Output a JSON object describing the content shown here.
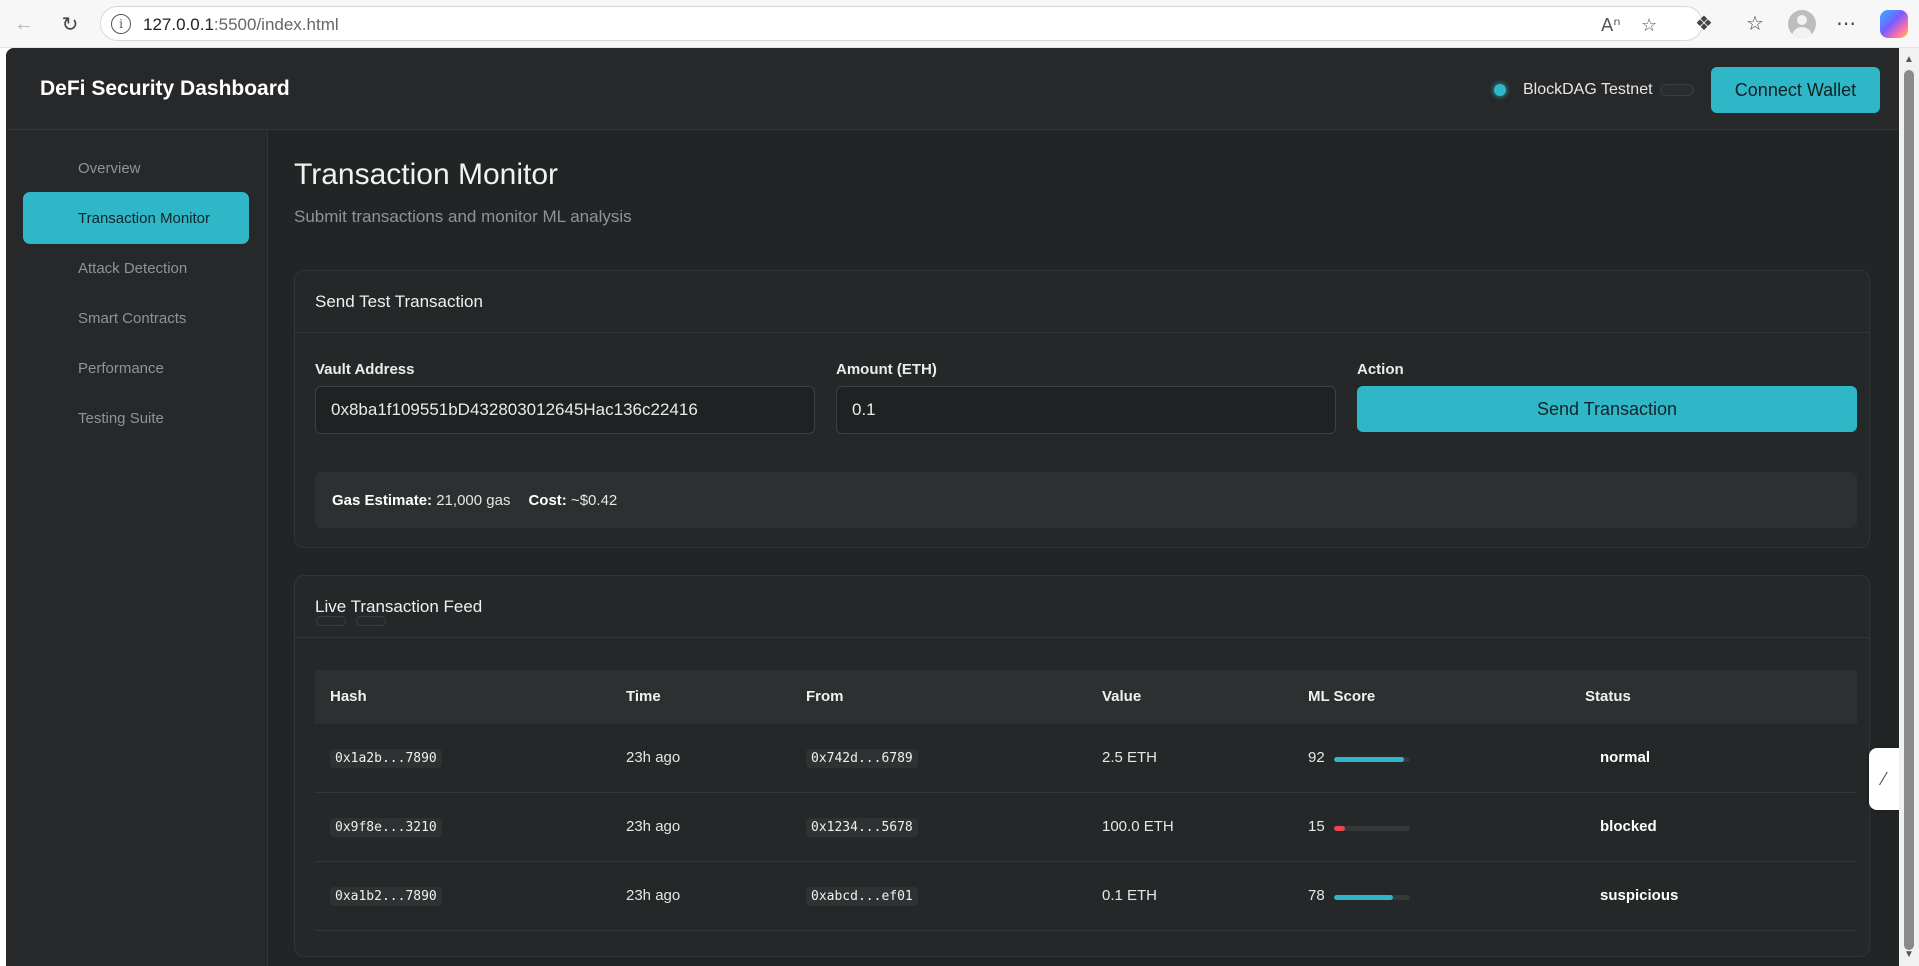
{
  "browser": {
    "url_host": "127.0.0.1",
    "url_path": ":5500/index.html"
  },
  "header": {
    "title": "DeFi Security Dashboard",
    "network_label": "BlockDAG Testnet",
    "connect_label": "Connect Wallet"
  },
  "sidebar": {
    "items": [
      {
        "label": "Overview",
        "active": false
      },
      {
        "label": "Transaction Monitor",
        "active": true
      },
      {
        "label": "Attack Detection",
        "active": false
      },
      {
        "label": "Smart Contracts",
        "active": false
      },
      {
        "label": "Performance",
        "active": false
      },
      {
        "label": "Testing Suite",
        "active": false
      }
    ]
  },
  "page": {
    "title": "Transaction Monitor",
    "subtitle": "Submit transactions and monitor ML analysis"
  },
  "send_card": {
    "title": "Send Test Transaction",
    "vault_label": "Vault Address",
    "vault_value": "0x8ba1f109551bD432803012645Hac136c22416",
    "amount_label": "Amount (ETH)",
    "amount_value": "0.1",
    "action_label": "Action",
    "send_label": "Send Transaction",
    "gas_label": "Gas Estimate:",
    "gas_value": "21,000 gas",
    "cost_label": "Cost:",
    "cost_value": "~$0.42"
  },
  "feed": {
    "title": "Live Transaction Feed",
    "columns": [
      "Hash",
      "Time",
      "From",
      "Value",
      "ML Score",
      "Status"
    ],
    "rows": [
      {
        "hash": "0x1a2b...7890",
        "time": "23h ago",
        "from": "0x742d...6789",
        "value": "2.5 ETH",
        "score": "92",
        "score_fraction": 0.92,
        "bar_color": "#2fb7c8",
        "status": "normal"
      },
      {
        "hash": "0x9f8e...3210",
        "time": "23h ago",
        "from": "0x1234...5678",
        "value": "100.0 ETH",
        "score": "15",
        "score_fraction": 0.15,
        "bar_color": "#e5484d",
        "status": "blocked"
      },
      {
        "hash": "0xa1b2...7890",
        "time": "23h ago",
        "from": "0xabcd...ef01",
        "value": "0.1 ETH",
        "score": "78",
        "score_fraction": 0.78,
        "bar_color": "#2fb7c8",
        "status": "suspicious"
      }
    ]
  },
  "colors": {
    "accent": "#2fb7c8",
    "danger": "#e5484d",
    "background": "#222526"
  }
}
